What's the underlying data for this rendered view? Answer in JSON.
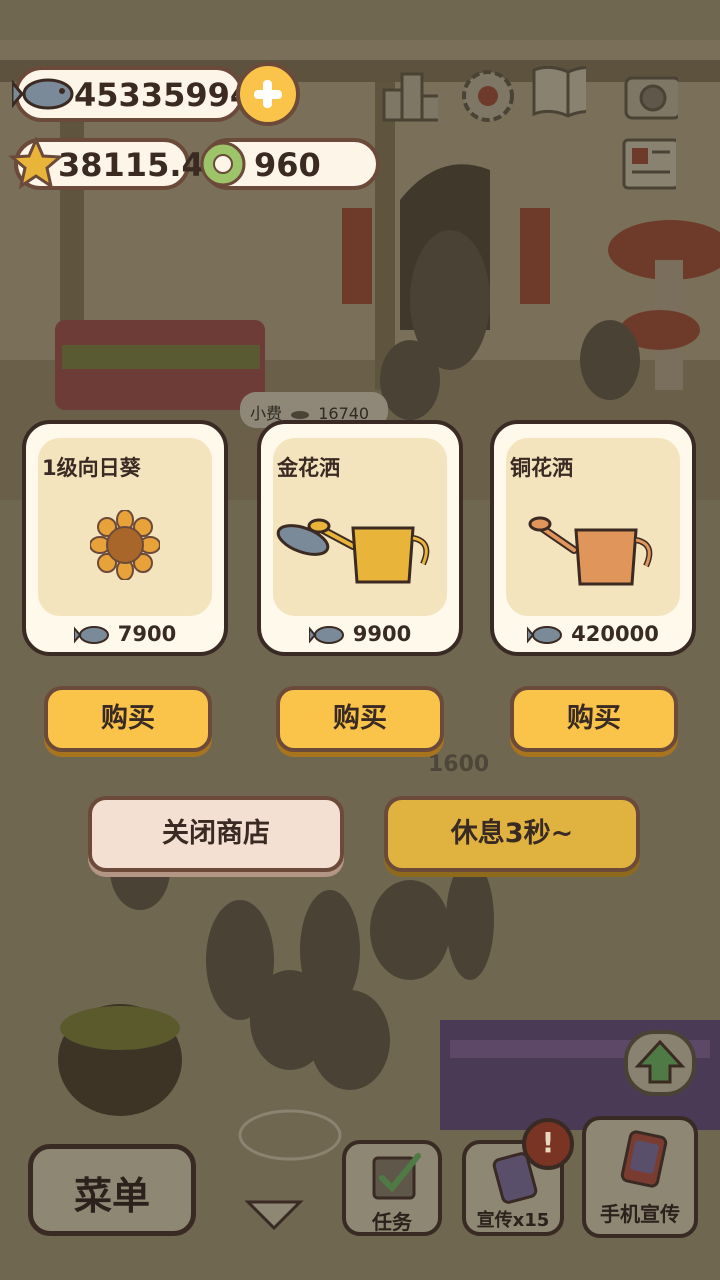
{
  "hud": {
    "fish_count": "45335994",
    "star_count": "38115.4",
    "coin_count": "960"
  },
  "tip": {
    "label": "小费",
    "amount": "16740"
  },
  "floating_text": "1600",
  "shop": {
    "items": [
      {
        "name": "1级向日葵",
        "price": "7900",
        "icon": "sunflower-icon"
      },
      {
        "name": "金花洒",
        "price": "9900",
        "icon": "gold-watering-can-icon"
      },
      {
        "name": "铜花洒",
        "price": "420000",
        "icon": "copper-watering-can-icon"
      }
    ],
    "buy_label": "购买",
    "close_label": "关闭商店",
    "rest_label": "休息3秒~"
  },
  "bottom": {
    "menu_label": "菜单",
    "tasks_label": "任务",
    "promo_label": "宣传x15",
    "phone_promo_label": "手机宣传",
    "alert_badge": "!"
  },
  "colors": {
    "buy_button": "#f9c449",
    "rest_button": "#e0b341",
    "close_button": "#f4e0d3",
    "outline": "#3a2a24",
    "overlay": "#6f6650"
  }
}
